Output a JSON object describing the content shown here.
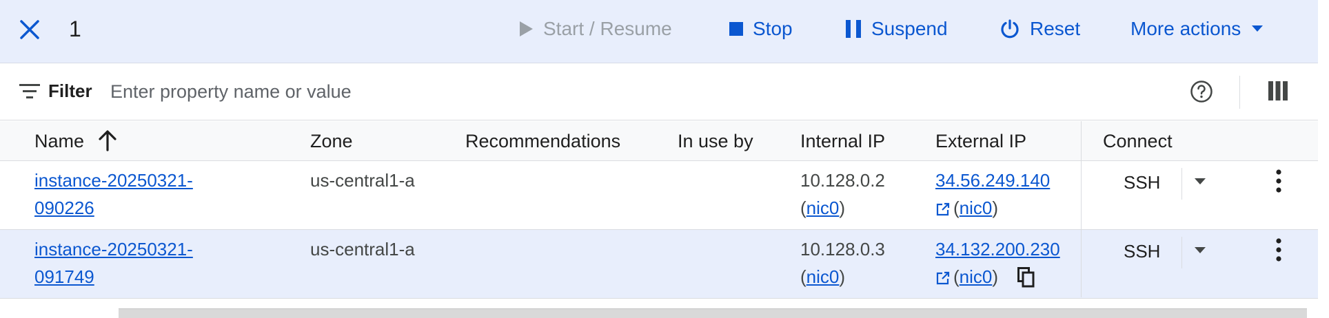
{
  "action_bar": {
    "selected_count": "1",
    "start_resume": "Start / Resume",
    "stop": "Stop",
    "suspend": "Suspend",
    "reset": "Reset",
    "more_actions": "More actions"
  },
  "filter": {
    "label": "Filter",
    "placeholder": "Enter property name or value"
  },
  "columns": [
    "Name",
    "Zone",
    "Recommendations",
    "In use by",
    "Internal IP",
    "External IP",
    "Connect"
  ],
  "rows": [
    {
      "name_line1": "instance-20250321-",
      "name_line2": "090226",
      "zone": "us-central1-a",
      "recommendations": "",
      "in_use_by": "",
      "internal_ip": "10.128.0.2",
      "internal_nic": "nic0",
      "external_ip": "34.56.249.140",
      "external_nic": "nic0",
      "connect": "SSH"
    },
    {
      "name_line1": "instance-20250321-",
      "name_line2": "091749",
      "zone": "us-central1-a",
      "recommendations": "",
      "in_use_by": "",
      "internal_ip": "10.128.0.3",
      "internal_nic": "nic0",
      "external_ip": "34.132.200.230",
      "external_nic": "nic0",
      "connect": "SSH"
    }
  ],
  "colors": {
    "accent": "#0b57d0",
    "selected_row": "#e8eefc",
    "disabled": "#9aa0a6"
  },
  "icons": [
    "close-icon",
    "play-icon",
    "stop-icon",
    "pause-icon",
    "power-icon",
    "caret-down-icon",
    "filter-icon",
    "help-icon",
    "columns-icon",
    "arrow-up-icon",
    "external-link-icon",
    "copy-icon",
    "more-vert-icon"
  ]
}
